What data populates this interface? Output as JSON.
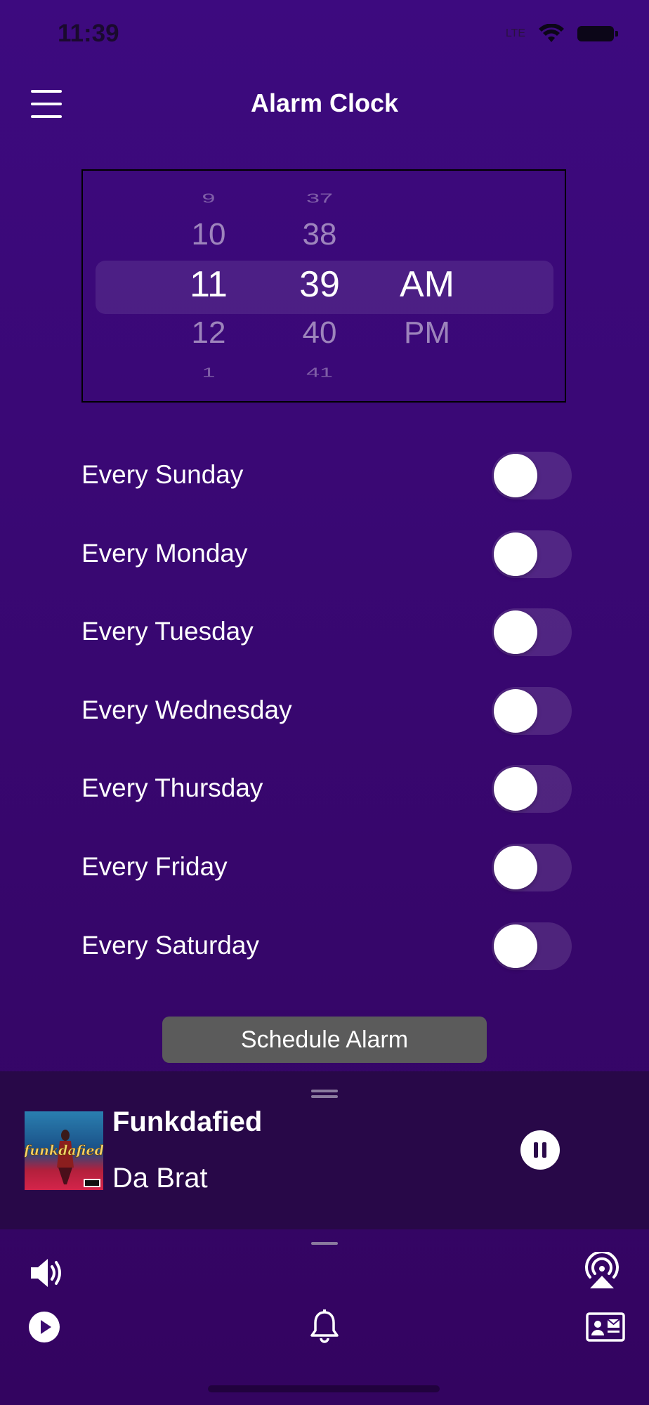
{
  "status_bar": {
    "time": "11:39",
    "signal": "LTE"
  },
  "header": {
    "title": "Alarm Clock",
    "menu_icon": "hamburger-menu-icon"
  },
  "time_picker": {
    "hours": [
      "9",
      "10",
      "11",
      "12",
      "1"
    ],
    "minutes": [
      "37",
      "38",
      "39",
      "40",
      "41"
    ],
    "period": [
      "AM",
      "PM"
    ],
    "selected": {
      "hour": "11",
      "minute": "39",
      "period": "AM"
    }
  },
  "repeat_days": [
    {
      "label": "Every Sunday",
      "enabled": false
    },
    {
      "label": "Every Monday",
      "enabled": false
    },
    {
      "label": "Every Tuesday",
      "enabled": false
    },
    {
      "label": "Every Wednesday",
      "enabled": false
    },
    {
      "label": "Every Thursday",
      "enabled": false
    },
    {
      "label": "Every Friday",
      "enabled": false
    },
    {
      "label": "Every Saturday",
      "enabled": false
    }
  ],
  "schedule_button": {
    "label": "Schedule Alarm"
  },
  "now_playing": {
    "title": "Funkdafied",
    "artist": "Da Brat",
    "album_art_text": "funkdafied",
    "state_icon": "pause-icon"
  },
  "bottom_bar": {
    "icons": [
      "volume-icon",
      "airplay-icon",
      "play-icon",
      "bell-icon",
      "contact-card-icon"
    ]
  },
  "colors": {
    "background": "#3d0a7f",
    "now_playing_background": "#280848",
    "button_background": "#5b5b5b",
    "toggle_off": "#5a2f85"
  }
}
